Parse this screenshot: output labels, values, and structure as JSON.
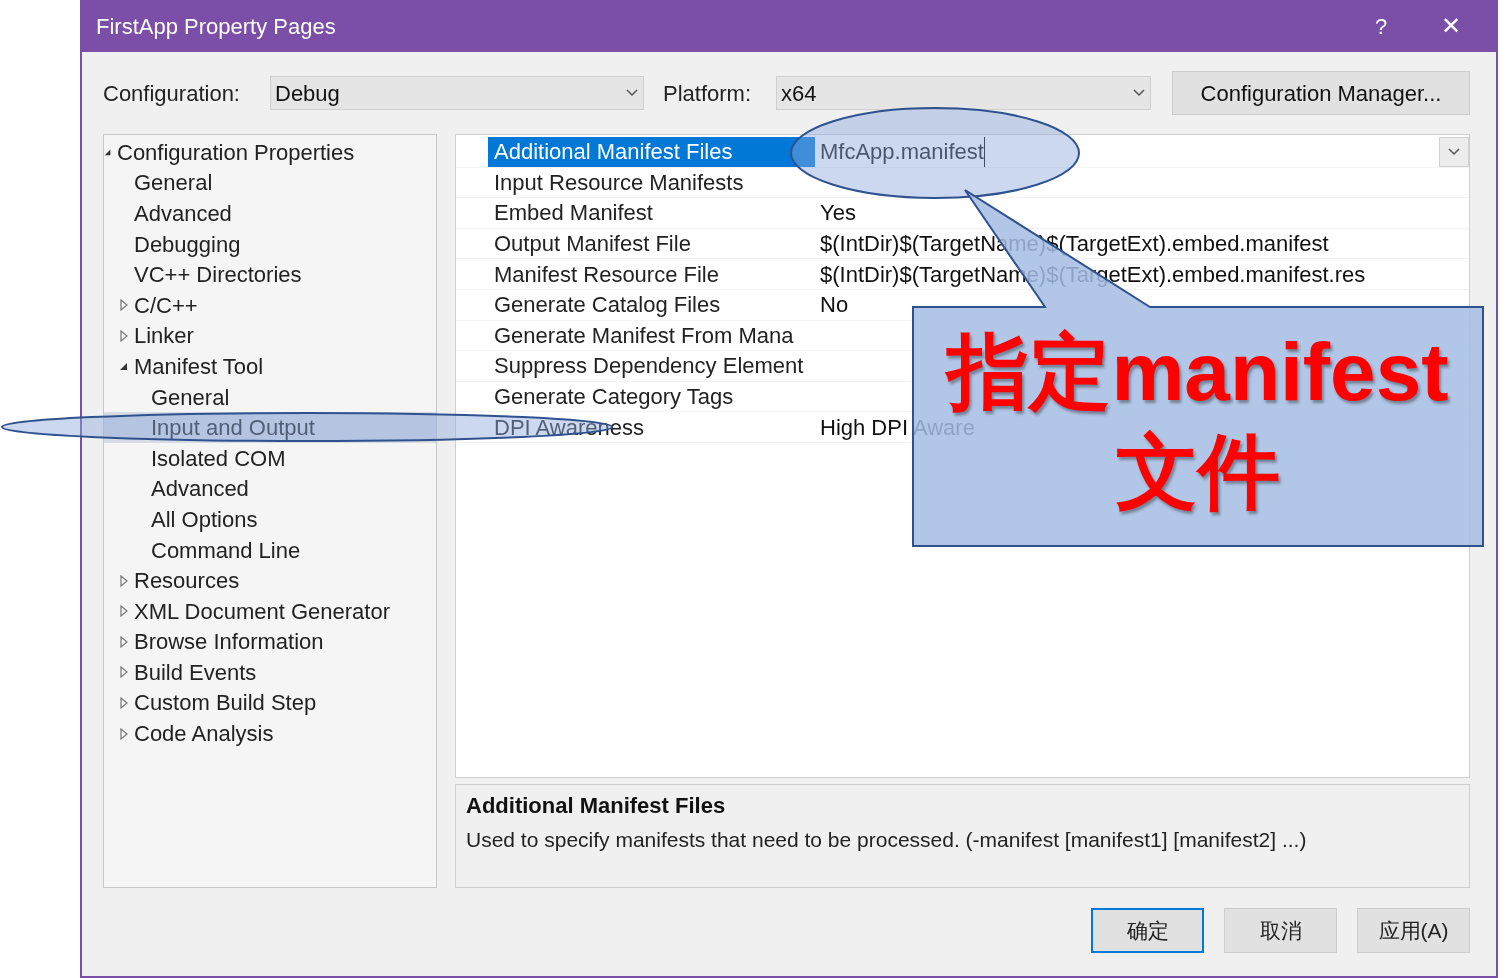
{
  "window": {
    "title": "FirstApp Property Pages",
    "help": "?",
    "close": "✕"
  },
  "configuration": {
    "label": "Configuration:",
    "value": "Debug"
  },
  "platform": {
    "label": "Platform:",
    "value": "x64"
  },
  "configuration_manager": "Configuration Manager...",
  "tree": [
    {
      "label": "Configuration Properties",
      "expanded": true,
      "selected": false,
      "children": [
        {
          "label": "General",
          "selected": false
        },
        {
          "label": "Advanced",
          "selected": false
        },
        {
          "label": "Debugging",
          "selected": false
        },
        {
          "label": "VC++ Directories",
          "selected": false
        },
        {
          "label": "C/C++",
          "expanded": false,
          "selected": false
        },
        {
          "label": "Linker",
          "expanded": false,
          "selected": false
        },
        {
          "label": "Manifest Tool",
          "expanded": true,
          "selected": false,
          "children": [
            {
              "label": "General",
              "selected": false
            },
            {
              "label": "Input and Output",
              "selected": true
            },
            {
              "label": "Isolated COM",
              "selected": false
            },
            {
              "label": "Advanced",
              "selected": false
            },
            {
              "label": "All Options",
              "selected": false
            },
            {
              "label": "Command Line",
              "selected": false
            }
          ]
        },
        {
          "label": "Resources",
          "expanded": false,
          "selected": false
        },
        {
          "label": "XML Document Generator",
          "expanded": false,
          "selected": false
        },
        {
          "label": "Browse Information",
          "expanded": false,
          "selected": false
        },
        {
          "label": "Build Events",
          "expanded": false,
          "selected": false
        },
        {
          "label": "Custom Build Step",
          "expanded": false,
          "selected": false
        },
        {
          "label": "Code Analysis",
          "expanded": false,
          "selected": false
        }
      ]
    }
  ],
  "properties": [
    {
      "name": "Additional Manifest Files",
      "value": "MfcApp.manifest",
      "selected": true
    },
    {
      "name": "Input Resource Manifests",
      "selected": false
    },
    {
      "name": "Embed Manifest",
      "value": "Yes",
      "selected": false
    },
    {
      "name": "Output Manifest File",
      "value": "$(IntDir)$(TargetName)$(TargetExt).embed.manifest",
      "selected": false
    },
    {
      "name": "Manifest Resource File",
      "value": "$(IntDir)$(TargetName)$(TargetExt).embed.manifest.res",
      "selected": false
    },
    {
      "name": "Generate Catalog Files",
      "value": "No",
      "selected": false
    },
    {
      "name": "Generate Manifest From Mana",
      "selected": false
    },
    {
      "name": "Suppress Dependency Element",
      "selected": false
    },
    {
      "name": "Generate Category Tags",
      "selected": false
    },
    {
      "name": "DPI Awareness",
      "value": "High DPI Aware",
      "selected": false
    }
  ],
  "description": {
    "title": "Additional Manifest Files",
    "text": "Used to specify manifests that need to be processed. (-manifest [manifest1] [manifest2] ...)"
  },
  "buttons": [
    {
      "label": "确定",
      "default": true
    },
    {
      "label": "取消",
      "default": false
    },
    {
      "label": "应用(A)",
      "default": false
    }
  ],
  "annotation": {
    "lines": [
      "指定manifest",
      "文件"
    ]
  }
}
